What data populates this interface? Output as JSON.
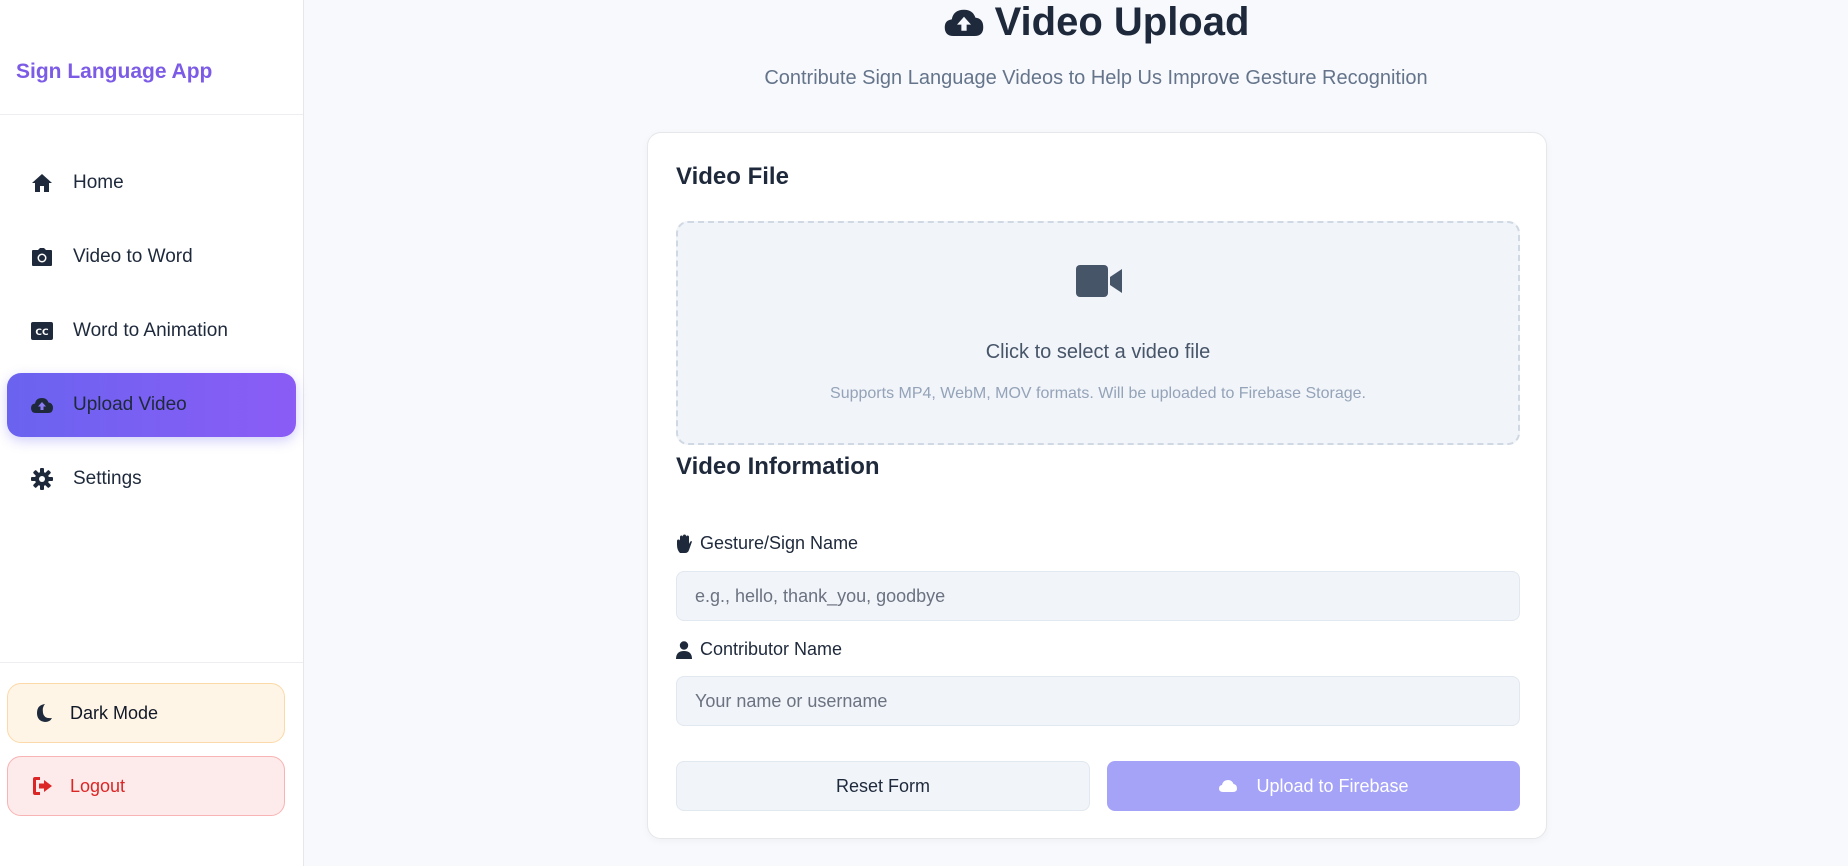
{
  "sidebar": {
    "brand": "Sign Language App",
    "nav": [
      {
        "label": "Home",
        "icon": "home-icon"
      },
      {
        "label": "Video to Word",
        "icon": "camera-icon"
      },
      {
        "label": "Word to Animation",
        "icon": "closed-captions-icon"
      },
      {
        "label": "Upload Video",
        "icon": "cloud-upload-icon",
        "active": true
      },
      {
        "label": "Settings",
        "icon": "gear-icon"
      }
    ],
    "dark_mode_label": "Dark Mode",
    "logout_label": "Logout"
  },
  "header": {
    "title": "Video Upload",
    "subtitle": "Contribute Sign Language Videos to Help Us Improve Gesture Recognition"
  },
  "form": {
    "video_file_title": "Video File",
    "dropzone_main": "Click to select a video file",
    "dropzone_sub": "Supports MP4, WebM, MOV formats. Will be uploaded to Firebase Storage.",
    "video_info_title": "Video Information",
    "gesture_label": "Gesture/Sign Name",
    "gesture_placeholder": "e.g., hello, thank_you, goodbye",
    "contributor_label": "Contributor Name",
    "contributor_placeholder": "Your name or username",
    "reset_label": "Reset Form",
    "upload_label": "Upload to Firebase"
  },
  "colors": {
    "accent": "#7c5ce6",
    "active_gradient_start": "#6a63f0",
    "active_gradient_end": "#8b5cf6",
    "upload_button": "#a5a3f7",
    "logout_text": "#dc2626"
  }
}
